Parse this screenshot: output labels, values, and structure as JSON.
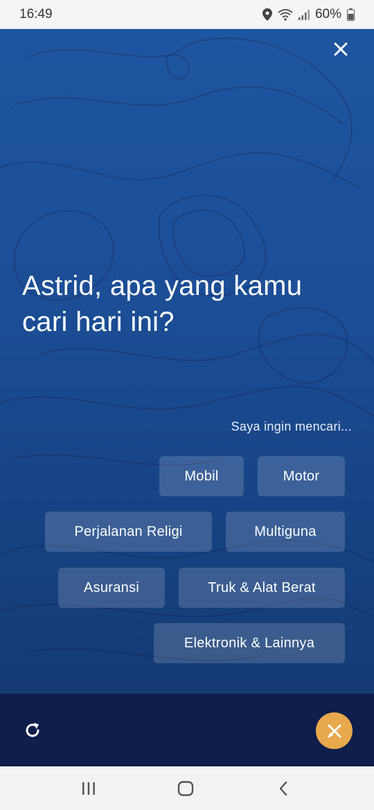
{
  "status_bar": {
    "time": "16:49",
    "battery": "60%",
    "icons": [
      "location-icon",
      "wifi-icon",
      "signal-icon",
      "battery-icon"
    ]
  },
  "hero": {
    "close_icon": "close-icon",
    "headline": "Astrid, apa yang kamu cari hari ini?",
    "prompt": "Saya ingin mencari..."
  },
  "options": [
    {
      "id": "mobil",
      "label": "Mobil"
    },
    {
      "id": "motor",
      "label": "Motor"
    },
    {
      "id": "perjalanan-religi",
      "label": "Perjalanan Religi"
    },
    {
      "id": "multiguna",
      "label": "Multiguna"
    },
    {
      "id": "asuransi",
      "label": "Asuransi"
    },
    {
      "id": "truk-alat-berat",
      "label": "Truk & Alat Berat"
    },
    {
      "id": "elektronik-lainnya",
      "label": "Elektronik & Lainnya"
    }
  ],
  "bottom": {
    "refresh_icon": "refresh-icon",
    "fab_icon": "close-tools-icon",
    "fab_color": "#e8a84c"
  },
  "nav": {
    "icons": [
      "recent-apps-icon",
      "home-icon",
      "back-icon"
    ]
  },
  "colors": {
    "hero_top": "#1e55a0",
    "hero_bottom": "#153a73",
    "panel": "#0f1e4a"
  }
}
